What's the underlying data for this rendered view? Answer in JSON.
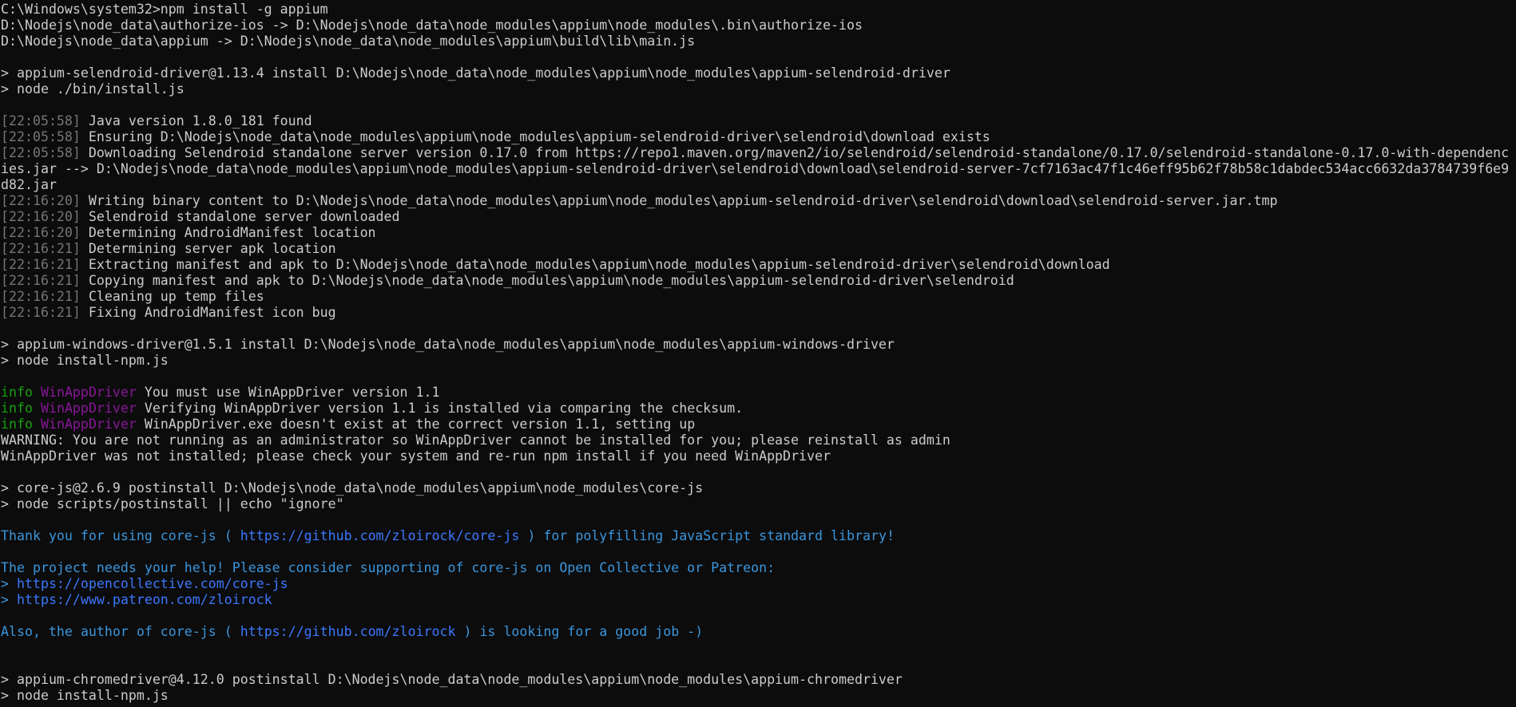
{
  "window": {
    "type": "console",
    "background": "#0c0c0c",
    "foreground": "#cccccc"
  },
  "palette": {
    "default": "#cccccc",
    "gray": "#767676",
    "green": "#13a10e",
    "magenta": "#881798",
    "cyan": "#3a96dd",
    "blue": "#3b78ff"
  },
  "lines": [
    [
      {
        "t": "C:\\Windows\\system32>npm install -g appium",
        "c": "default"
      }
    ],
    [
      {
        "t": "D:\\Nodejs\\node_data\\authorize-ios -> D:\\Nodejs\\node_data\\node_modules\\appium\\node_modules\\.bin\\authorize-ios",
        "c": "default"
      }
    ],
    [
      {
        "t": "D:\\Nodejs\\node_data\\appium -> D:\\Nodejs\\node_data\\node_modules\\appium\\build\\lib\\main.js",
        "c": "default"
      }
    ],
    [],
    [
      {
        "t": "> appium-selendroid-driver@1.13.4 install D:\\Nodejs\\node_data\\node_modules\\appium\\node_modules\\appium-selendroid-driver",
        "c": "default"
      }
    ],
    [
      {
        "t": "> node ./bin/install.js",
        "c": "default"
      }
    ],
    [],
    [
      {
        "t": "[22:05:58]",
        "c": "gray"
      },
      {
        "t": " Java version 1.8.0_181 found",
        "c": "default"
      }
    ],
    [
      {
        "t": "[22:05:58]",
        "c": "gray"
      },
      {
        "t": " Ensuring D:\\Nodejs\\node_data\\node_modules\\appium\\node_modules\\appium-selendroid-driver\\selendroid\\download exists",
        "c": "default"
      }
    ],
    [
      {
        "t": "[22:05:58]",
        "c": "gray"
      },
      {
        "t": " Downloading Selendroid standalone server version 0.17.0 from https://repo1.maven.org/maven2/io/selendroid/selendroid-standalone/0.17.0/selendroid-standalone-0.17.0-with-dependenc",
        "c": "default"
      }
    ],
    [
      {
        "t": "ies.jar --> D:\\Nodejs\\node_data\\node_modules\\appium\\node_modules\\appium-selendroid-driver\\selendroid\\download\\selendroid-server-7cf7163ac47f1c46eff95b62f78b58c1dabdec534acc6632da3784739f6e9",
        "c": "default"
      }
    ],
    [
      {
        "t": "d82.jar",
        "c": "default"
      }
    ],
    [
      {
        "t": "[22:16:20]",
        "c": "gray"
      },
      {
        "t": " Writing binary content to D:\\Nodejs\\node_data\\node_modules\\appium\\node_modules\\appium-selendroid-driver\\selendroid\\download\\selendroid-server.jar.tmp",
        "c": "default"
      }
    ],
    [
      {
        "t": "[22:16:20]",
        "c": "gray"
      },
      {
        "t": " Selendroid standalone server downloaded",
        "c": "default"
      }
    ],
    [
      {
        "t": "[22:16:20]",
        "c": "gray"
      },
      {
        "t": " Determining AndroidManifest location",
        "c": "default"
      }
    ],
    [
      {
        "t": "[22:16:21]",
        "c": "gray"
      },
      {
        "t": " Determining server apk location",
        "c": "default"
      }
    ],
    [
      {
        "t": "[22:16:21]",
        "c": "gray"
      },
      {
        "t": " Extracting manifest and apk to D:\\Nodejs\\node_data\\node_modules\\appium\\node_modules\\appium-selendroid-driver\\selendroid\\download",
        "c": "default"
      }
    ],
    [
      {
        "t": "[22:16:21]",
        "c": "gray"
      },
      {
        "t": " Copying manifest and apk to D:\\Nodejs\\node_data\\node_modules\\appium\\node_modules\\appium-selendroid-driver\\selendroid",
        "c": "default"
      }
    ],
    [
      {
        "t": "[22:16:21]",
        "c": "gray"
      },
      {
        "t": " Cleaning up temp files",
        "c": "default"
      }
    ],
    [
      {
        "t": "[22:16:21]",
        "c": "gray"
      },
      {
        "t": " Fixing AndroidManifest icon bug",
        "c": "default"
      }
    ],
    [],
    [
      {
        "t": "> appium-windows-driver@1.5.1 install D:\\Nodejs\\node_data\\node_modules\\appium\\node_modules\\appium-windows-driver",
        "c": "default"
      }
    ],
    [
      {
        "t": "> node install-npm.js",
        "c": "default"
      }
    ],
    [],
    [
      {
        "t": "info",
        "c": "green"
      },
      {
        "t": " ",
        "c": "default"
      },
      {
        "t": "WinAppDriver",
        "c": "magenta"
      },
      {
        "t": " You must use WinAppDriver version 1.1",
        "c": "default"
      }
    ],
    [
      {
        "t": "info",
        "c": "green"
      },
      {
        "t": " ",
        "c": "default"
      },
      {
        "t": "WinAppDriver",
        "c": "magenta"
      },
      {
        "t": " Verifying WinAppDriver version 1.1 is installed via comparing the checksum.",
        "c": "default"
      }
    ],
    [
      {
        "t": "info",
        "c": "green"
      },
      {
        "t": " ",
        "c": "default"
      },
      {
        "t": "WinAppDriver",
        "c": "magenta"
      },
      {
        "t": " WinAppDriver.exe doesn't exist at the correct version 1.1, setting up",
        "c": "default"
      }
    ],
    [
      {
        "t": "WARNING: You are not running as an administrator so WinAppDriver cannot be installed for you; please reinstall as admin",
        "c": "default"
      }
    ],
    [
      {
        "t": "WinAppDriver was not installed; please check your system and re-run npm install if you need WinAppDriver",
        "c": "default"
      }
    ],
    [],
    [
      {
        "t": "> core-js@2.6.9 postinstall D:\\Nodejs\\node_data\\node_modules\\appium\\node_modules\\core-js",
        "c": "default"
      }
    ],
    [
      {
        "t": "> node scripts/postinstall || echo \"ignore\"",
        "c": "default"
      }
    ],
    [],
    [
      {
        "t": "Thank you for using core-js ( ",
        "c": "cyan"
      },
      {
        "t": "https://github.com/zloirock/core-js",
        "c": "blue"
      },
      {
        "t": " ) for polyfilling JavaScript standard library!",
        "c": "cyan"
      }
    ],
    [],
    [
      {
        "t": "The project needs your help! Please consider supporting of core-js on Open Collective or Patreon:",
        "c": "cyan"
      }
    ],
    [
      {
        "t": "> ",
        "c": "cyan"
      },
      {
        "t": "https://opencollective.com/core-js",
        "c": "blue"
      }
    ],
    [
      {
        "t": "> ",
        "c": "cyan"
      },
      {
        "t": "https://www.patreon.com/zloirock",
        "c": "blue"
      }
    ],
    [],
    [
      {
        "t": "Also, the author of core-js ( ",
        "c": "cyan"
      },
      {
        "t": "https://github.com/zloirock",
        "c": "blue"
      },
      {
        "t": " ) is looking for a good job -)",
        "c": "cyan"
      }
    ],
    [],
    [],
    [
      {
        "t": "> appium-chromedriver@4.12.0 postinstall D:\\Nodejs\\node_data\\node_modules\\appium\\node_modules\\appium-chromedriver",
        "c": "default"
      }
    ],
    [
      {
        "t": "> node install-npm.js",
        "c": "default"
      }
    ]
  ]
}
